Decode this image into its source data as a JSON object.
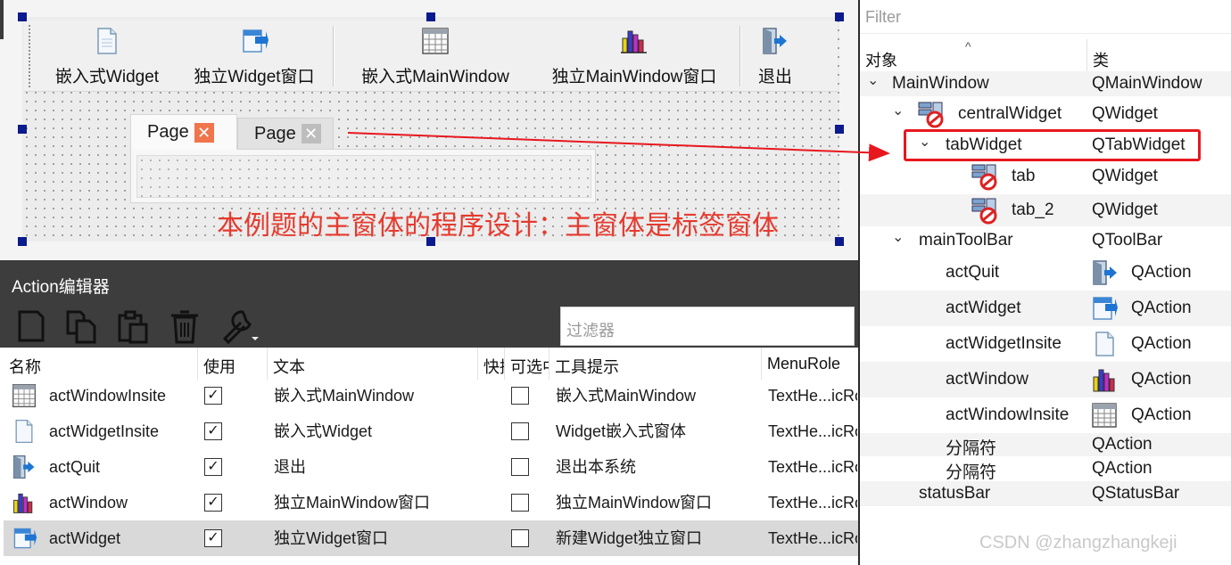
{
  "designer": {
    "toolbar": [
      {
        "label": "嵌入式Widget",
        "icon": "document-icon"
      },
      {
        "label": "独立Widget窗口",
        "icon": "new-window-icon"
      },
      {
        "label": "嵌入式MainWindow",
        "icon": "table-icon"
      },
      {
        "label": "独立MainWindow窗口",
        "icon": "bar-chart-icon"
      },
      {
        "label": "退出",
        "icon": "exit-door-icon"
      }
    ],
    "tabs": [
      {
        "label": "Page",
        "close": "✕"
      },
      {
        "label": "Page",
        "close": "✕"
      }
    ],
    "annotation": "本例题的主窗体的程序设计：主窗体是标签窗体",
    "annotation_color": "#e63a2e"
  },
  "action_editor": {
    "title": "Action编辑器",
    "toolbar_icons": [
      "new-icon",
      "copy-icon",
      "paste-icon",
      "delete-icon",
      "configure-wrench-icon"
    ],
    "filter_placeholder": "过滤器",
    "columns": [
      "名称",
      "使用",
      "文本",
      "快捷",
      "可选中",
      "工具提示",
      "MenuRole"
    ],
    "rows": [
      {
        "name": "actWindowInsite",
        "icon": "table-icon",
        "used": true,
        "text": "嵌入式MainWindow",
        "checkable": false,
        "tooltip": "嵌入式MainWindow",
        "menu_role": "TextHe...icRole",
        "selected": false
      },
      {
        "name": "actWidgetInsite",
        "icon": "document-icon",
        "used": true,
        "text": "嵌入式Widget",
        "checkable": false,
        "tooltip": "Widget嵌入式窗体",
        "menu_role": "TextHe...icRole",
        "selected": false
      },
      {
        "name": "actQuit",
        "icon": "exit-door-icon",
        "used": true,
        "text": "退出",
        "checkable": false,
        "tooltip": "退出本系统",
        "menu_role": "TextHe...icRole",
        "selected": false
      },
      {
        "name": "actWindow",
        "icon": "bar-chart-icon",
        "used": true,
        "text": "独立MainWindow窗口",
        "checkable": false,
        "tooltip": "独立MainWindow窗口",
        "menu_role": "TextHe...icRole",
        "selected": false
      },
      {
        "name": "actWidget",
        "icon": "new-window-icon",
        "used": true,
        "text": "独立Widget窗口",
        "checkable": false,
        "tooltip": "新建Widget独立窗口",
        "menu_role": "TextHe...icRole",
        "selected": true
      }
    ]
  },
  "object_inspector": {
    "filter_placeholder": "Filter",
    "sort_indicator": "^",
    "columns": [
      "对象",
      "类"
    ],
    "rows": [
      {
        "name": "MainWindow",
        "class": "QMainWindow",
        "expander": "⌄",
        "icon": ""
      },
      {
        "name": "centralWidget",
        "class": "QWidget",
        "expander": "⌄",
        "icon": "widget-layout-broken-icon"
      },
      {
        "name": "tabWidget",
        "class": "QTabWidget",
        "expander": "⌄",
        "icon": ""
      },
      {
        "name": "tab",
        "class": "QWidget",
        "expander": "",
        "icon": "widget-layout-broken-icon"
      },
      {
        "name": "tab_2",
        "class": "QWidget",
        "expander": "",
        "icon": "widget-layout-broken-icon"
      },
      {
        "name": "mainToolBar",
        "class": "QToolBar",
        "expander": "⌄",
        "icon": ""
      },
      {
        "name": "actQuit",
        "class": "QAction",
        "expander": "",
        "icon": "exit-door-icon"
      },
      {
        "name": "actWidget",
        "class": "QAction",
        "expander": "",
        "icon": "new-window-icon"
      },
      {
        "name": "actWidgetInsite",
        "class": "QAction",
        "expander": "",
        "icon": "document-icon"
      },
      {
        "name": "actWindow",
        "class": "QAction",
        "expander": "",
        "icon": "bar-chart-icon"
      },
      {
        "name": "actWindowInsite",
        "class": "QAction",
        "expander": "",
        "icon": "table-icon"
      },
      {
        "name": "分隔符",
        "class": "QAction",
        "expander": "",
        "icon": ""
      },
      {
        "name": "分隔符",
        "class": "QAction",
        "expander": "",
        "icon": ""
      },
      {
        "name": "statusBar",
        "class": "QStatusBar",
        "expander": "",
        "icon": ""
      }
    ],
    "highlight_color": "#e8171e"
  },
  "watermark": "CSDN @zhangzhangkeji"
}
